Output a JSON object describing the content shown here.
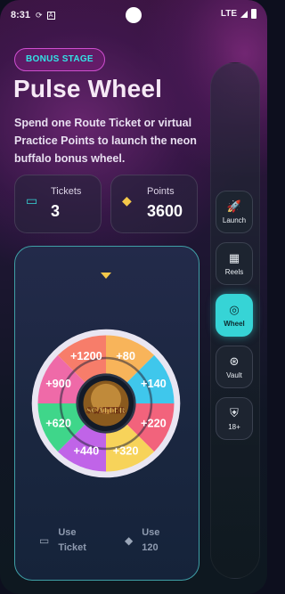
{
  "status_bar": {
    "time": "8:31",
    "network": "LTE"
  },
  "badge": "BONUS STAGE",
  "title": "Pulse Wheel",
  "description": "Spend one Route Ticket or virtual Practice Points to launch the neon buffalo bonus wheel.",
  "stats": {
    "tickets": {
      "label": "Tickets",
      "value": "3",
      "icon": "ticket-icon"
    },
    "points": {
      "label": "Points",
      "value": "3600",
      "icon": "diamond-icon"
    }
  },
  "rail": [
    {
      "label": "Launch",
      "icon": "rocket-icon"
    },
    {
      "label": "Reels",
      "icon": "grid-icon"
    },
    {
      "label": "Wheel",
      "icon": "target-icon",
      "active": true
    },
    {
      "label": "Vault",
      "icon": "badge-icon"
    },
    {
      "label": "18+",
      "icon": "shield-check-icon"
    }
  ],
  "wheel": {
    "center_label": "SCATTER",
    "segments": [
      "+1200",
      "+80",
      "+140",
      "+220",
      "+320",
      "+440",
      "+620",
      "+900"
    ],
    "colors": [
      "#f77d6a",
      "#f8b45a",
      "#3fc7ec",
      "#f2637c",
      "#f7d35a",
      "#c064e8",
      "#3fd68a",
      "#ef6aa8"
    ]
  },
  "footer": {
    "use_ticket": "Use Ticket",
    "use_points": "Use 120"
  },
  "colors": {
    "accent": "#36d4d6",
    "badge_border": "#cf4fd0",
    "panel_border": "#3f9fa6"
  }
}
